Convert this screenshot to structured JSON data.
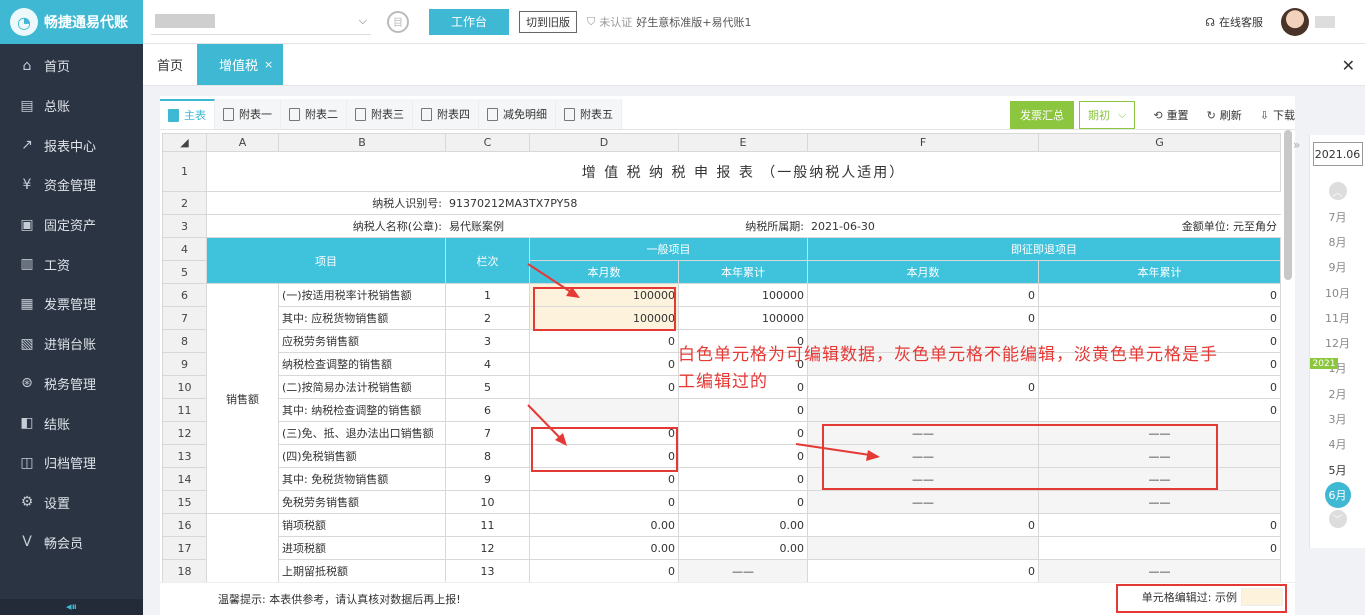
{
  "brand": {
    "name": "畅捷通易代账"
  },
  "sidebar": {
    "items": [
      {
        "label": "首页",
        "icon": "home-icon",
        "glyph": "⌂"
      },
      {
        "label": "总账",
        "icon": "ledger-icon",
        "glyph": "▤"
      },
      {
        "label": "报表中心",
        "icon": "chart-icon",
        "glyph": "↗"
      },
      {
        "label": "资金管理",
        "icon": "fund-icon",
        "glyph": "¥"
      },
      {
        "label": "固定资产",
        "icon": "asset-icon",
        "glyph": "▣"
      },
      {
        "label": "工资",
        "icon": "salary-icon",
        "glyph": "▥"
      },
      {
        "label": "发票管理",
        "icon": "invoice-icon",
        "glyph": "▦"
      },
      {
        "label": "进销台账",
        "icon": "inventory-icon",
        "glyph": "▧"
      },
      {
        "label": "税务管理",
        "icon": "tax-icon",
        "glyph": "⊛"
      },
      {
        "label": "结账",
        "icon": "checkout-icon",
        "glyph": "◧"
      },
      {
        "label": "归档管理",
        "icon": "archive-icon",
        "glyph": "◫"
      },
      {
        "label": "设置",
        "icon": "settings-icon",
        "glyph": "⚙"
      },
      {
        "label": "畅会员",
        "icon": "vip-icon",
        "glyph": "V"
      }
    ],
    "collapse_glyph": "◂⏸"
  },
  "topbar": {
    "work_label": "工作台",
    "old_version_label": "切到旧版",
    "verify_label": "未认证",
    "product_label": "好生意标准版+易代账1",
    "service_label": "在线客服"
  },
  "tabs": [
    {
      "label": "首页"
    },
    {
      "label": "增值税",
      "close": "×"
    }
  ],
  "subtabs": [
    {
      "label": "主表"
    },
    {
      "label": "附表一"
    },
    {
      "label": "附表二"
    },
    {
      "label": "附表三"
    },
    {
      "label": "附表四"
    },
    {
      "label": "减免明细"
    },
    {
      "label": "附表五"
    }
  ],
  "actions": {
    "summary": "发票汇总",
    "period": "期初",
    "reset": "重置",
    "refresh": "刷新",
    "download": "下载"
  },
  "sheet": {
    "columns": [
      "A",
      "B",
      "C",
      "D",
      "E",
      "F",
      "G"
    ],
    "title": "增 值 税 纳 税 申 报 表 （一般纳税人适用）",
    "taxpayer_id_label": "纳税人识别号:",
    "taxpayer_id": "91370212MA3TX7PY58",
    "taxpayer_name_label": "纳税人名称(公章):",
    "taxpayer_name": "易代账案例",
    "period_label": "纳税所属期:",
    "period": "2021-06-30",
    "unit_label": "金额单位: 元至角分",
    "header_item": "项目",
    "header_col": "栏次",
    "header_general": "一般项目",
    "header_refund": "即征即退项目",
    "header_month": "本月数",
    "header_year": "本年累计",
    "group_sales": "销售额",
    "rows": [
      {
        "rn": "6",
        "item": "(一)按适用税率计税销售额",
        "col": "1",
        "d": "100000",
        "e": "100000",
        "f": "0",
        "g": "0"
      },
      {
        "rn": "7",
        "item": "其中: 应税货物销售额",
        "col": "2",
        "d": "100000",
        "e": "100000",
        "f": "0",
        "g": "0"
      },
      {
        "rn": "8",
        "item": "应税劳务销售额",
        "col": "3",
        "d": "0",
        "e": "0",
        "f": "",
        "g": "0"
      },
      {
        "rn": "9",
        "item": "纳税检查调整的销售额",
        "col": "4",
        "d": "0",
        "e": "0",
        "f": "",
        "g": "0"
      },
      {
        "rn": "10",
        "item": "(二)按简易办法计税销售额",
        "col": "5",
        "d": "0",
        "e": "0",
        "f": "0",
        "g": "0"
      },
      {
        "rn": "11",
        "item": "其中: 纳税检查调整的销售额",
        "col": "6",
        "d": "",
        "e": "0",
        "f": "",
        "g": "0"
      },
      {
        "rn": "12",
        "item": "(三)免、抵、退办法出口销售额",
        "col": "7",
        "d": "0",
        "e": "0",
        "f": "——",
        "g": "——"
      },
      {
        "rn": "13",
        "item": "(四)免税销售额",
        "col": "8",
        "d": "0",
        "e": "0",
        "f": "——",
        "g": "——"
      },
      {
        "rn": "14",
        "item": "其中: 免税货物销售额",
        "col": "9",
        "d": "0",
        "e": "0",
        "f": "——",
        "g": "——"
      },
      {
        "rn": "15",
        "item": "免税劳务销售额",
        "col": "10",
        "d": "0",
        "e": "0",
        "f": "——",
        "g": "——"
      },
      {
        "rn": "16",
        "item": "销项税额",
        "col": "11",
        "d": "0.00",
        "e": "0.00",
        "f": "0",
        "g": "0"
      },
      {
        "rn": "17",
        "item": "进项税额",
        "col": "12",
        "d": "0.00",
        "e": "0.00",
        "f": "",
        "g": "0"
      },
      {
        "rn": "18",
        "item": "上期留抵税额",
        "col": "13",
        "d": "0",
        "e": "——",
        "f": "0",
        "g": "——"
      }
    ]
  },
  "footer": {
    "tip": "温馨提示: 本表供参考，请认真核对数据后再上报!",
    "legend": "单元格编辑过: 示例"
  },
  "months": {
    "year_value": "2021.06",
    "year_badge": "2021",
    "list": [
      "7月",
      "8月",
      "9月",
      "10月",
      "11月",
      "12月",
      "1月",
      "2月",
      "3月",
      "4月",
      "5月",
      "6月"
    ],
    "current": "6月"
  },
  "annotation": "白色单元格为可编辑数据，灰色单元格不能编辑，淡黄色单元格是手工编辑过的"
}
